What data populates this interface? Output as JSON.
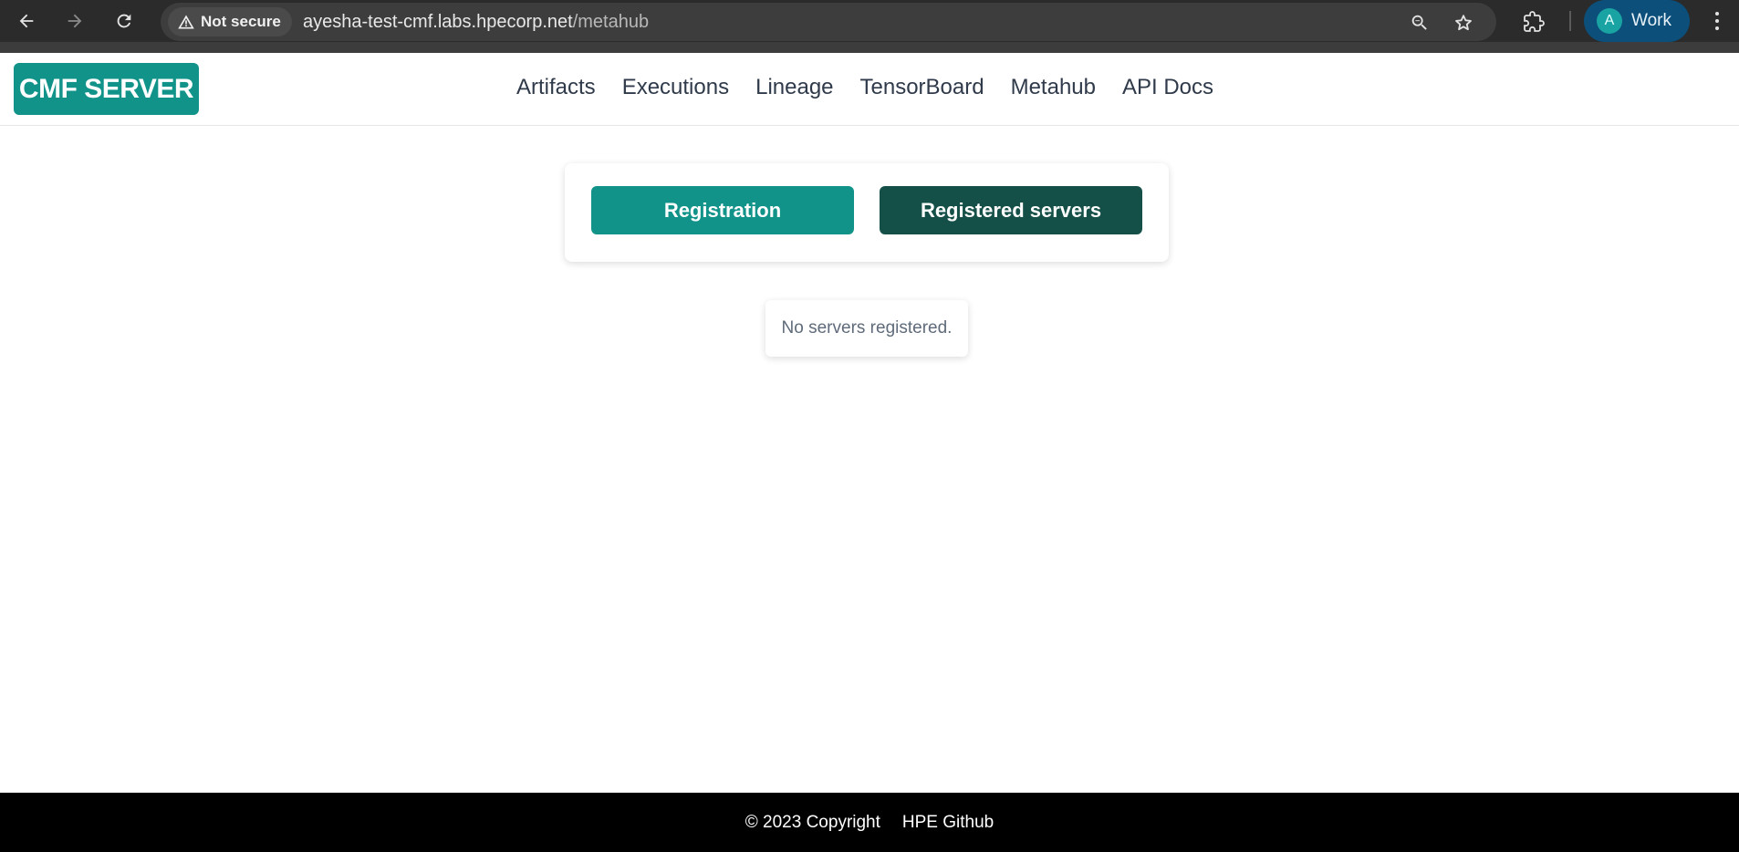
{
  "browser": {
    "security_label": "Not secure",
    "url_host": "ayesha-test-cmf.labs.hpecorp.net",
    "url_path": "/metahub",
    "profile_initial": "A",
    "profile_label": "Work"
  },
  "app": {
    "logo": "CMF SERVER",
    "nav": [
      "Artifacts",
      "Executions",
      "Lineage",
      "TensorBoard",
      "Metahub",
      "API Docs"
    ]
  },
  "metahub": {
    "registration_label": "Registration",
    "registered_servers_label": "Registered servers",
    "empty_message": "No servers registered."
  },
  "footer": {
    "copyright": "© 2023 Copyright",
    "github_link": "HPE Github"
  },
  "colors": {
    "brand": "#11938a",
    "brand_dark": "#145047",
    "footer_bg": "#000000"
  }
}
